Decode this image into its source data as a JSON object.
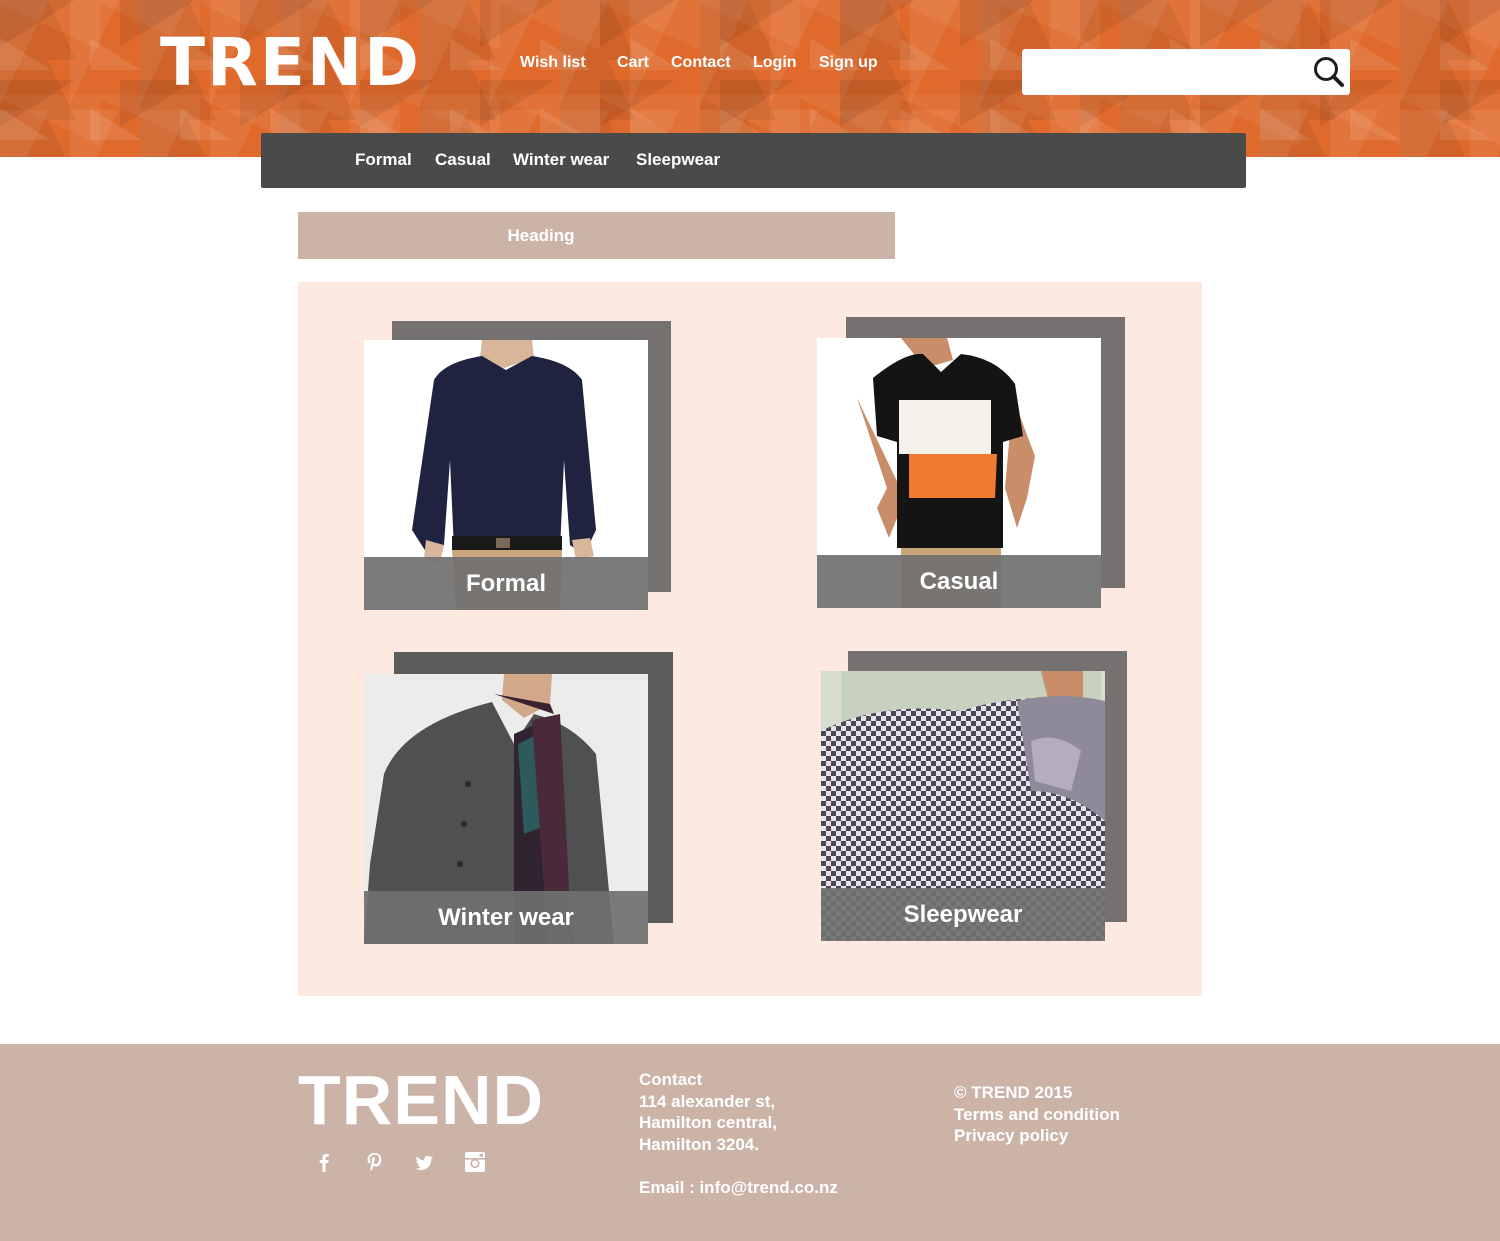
{
  "header": {
    "logo_text": "TREND",
    "nav": [
      "Wish list",
      "Cart",
      "Contact",
      "Login",
      "Sign up"
    ],
    "search": {
      "value": "",
      "placeholder": "",
      "icon": "search-icon"
    },
    "colors": {
      "header_bg": "#e06a2c",
      "category_bar": "#4a4a4a"
    }
  },
  "categories": [
    "Formal",
    "Casual",
    "Winter wear",
    "Sleepwear"
  ],
  "main": {
    "heading": "Heading",
    "tiles": [
      {
        "label": "Formal",
        "image": "formal-shirt-photo"
      },
      {
        "label": "Casual",
        "image": "casual-tshirt-photo"
      },
      {
        "label": "Winter wear",
        "image": "winter-coat-photo"
      },
      {
        "label": "Sleepwear",
        "image": "sleepwear-robe-photo"
      }
    ],
    "colors": {
      "panel_bg": "#fde9df",
      "heading_bg": "#cbb3a7"
    }
  },
  "footer": {
    "logo_text": "TREND",
    "social_icons": [
      "facebook-icon",
      "pinterest-icon",
      "twitter-icon",
      "instagram-icon"
    ],
    "contact": {
      "title": "Contact",
      "address_line1": "114 alexander st,",
      "address_line2": "Hamilton central,",
      "address_line3": "Hamilton 3204.",
      "email": "Email : info@trend.co.nz"
    },
    "legal": {
      "copyright": "© TREND 2015",
      "terms": "Terms and condition",
      "privacy": "Privacy policy"
    },
    "colors": {
      "footer_bg": "#cbb3a7"
    }
  }
}
